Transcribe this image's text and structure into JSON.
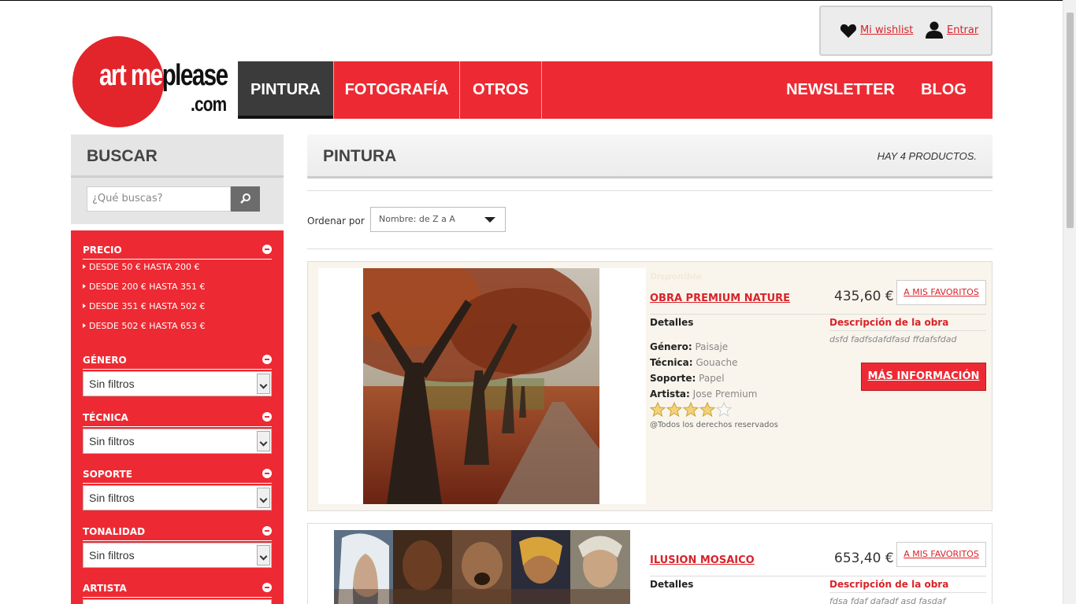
{
  "brand": {
    "logo_main_white": "art me",
    "logo_main_black": "please",
    "logo_domain": ".com"
  },
  "userbar": {
    "wishlist_label": "Mi wishlist",
    "login_label": "Entrar"
  },
  "nav": {
    "items": [
      {
        "label": "PINTURA",
        "active": true
      },
      {
        "label": "FOTOGRAFÍA",
        "active": false
      },
      {
        "label": "OTROS",
        "active": false
      },
      {
        "label": "NEWSLETTER",
        "active": false
      },
      {
        "label": "BLOG",
        "active": false
      }
    ]
  },
  "search": {
    "title": "BUSCAR",
    "placeholder": "¿Qué buscas?"
  },
  "filters": {
    "price": {
      "title": "PRECIO",
      "ranges": [
        "DESDE 50 € HASTA 200 €",
        "DESDE 200 € HASTA 351 €",
        "DESDE 351 € HASTA 502 €",
        "DESDE 502 € HASTA 653 €"
      ]
    },
    "groups": [
      {
        "title": "GÉNERO",
        "value": "Sin filtros"
      },
      {
        "title": "TÉCNICA",
        "value": "Sin filtros"
      },
      {
        "title": "SOPORTE",
        "value": "Sin filtros"
      },
      {
        "title": "TONALIDAD",
        "value": "Sin filtros"
      },
      {
        "title": "ARTISTA",
        "value": ""
      }
    ]
  },
  "main": {
    "title": "PINTURA",
    "product_count": "HAY 4 PRODUCTOS.",
    "sort_label": "Ordenar por",
    "sort_value": "Nombre: de Z a A"
  },
  "products": [
    {
      "status": "Disponible",
      "name": "OBRA PREMIUM NATURE",
      "price": "435,60 €",
      "fav_label": "A MIS FAVORITOS",
      "details_label": "Detalles",
      "desc_title": "Descripción de la obra",
      "desc": "dsfd fadfsdafdfasd ffdafsfdad",
      "attrs": [
        {
          "k": "Género:",
          "v": "Paisaje"
        },
        {
          "k": "Técnica:",
          "v": "Gouache"
        },
        {
          "k": "Soporte:",
          "v": "Papel"
        },
        {
          "k": "Artista:",
          "v": "Jose Premium"
        }
      ],
      "rating": 4,
      "rating_max": 5,
      "rights": "@Todos los derechos reservados",
      "more_label": "MÁS INFORMACIÓN"
    },
    {
      "name": "ILUSION MOSAICO",
      "price": "653,40 €",
      "fav_label": "A MIS FAVORITOS",
      "details_label": "Detalles",
      "desc_title": "Descripción de la obra",
      "desc": "fdsa fdaf dafadf asd fasdaf"
    }
  ],
  "colors": {
    "brand_red": "#ed2a33",
    "nav_active": "#3b3b3b",
    "link_red": "#d8232a"
  }
}
